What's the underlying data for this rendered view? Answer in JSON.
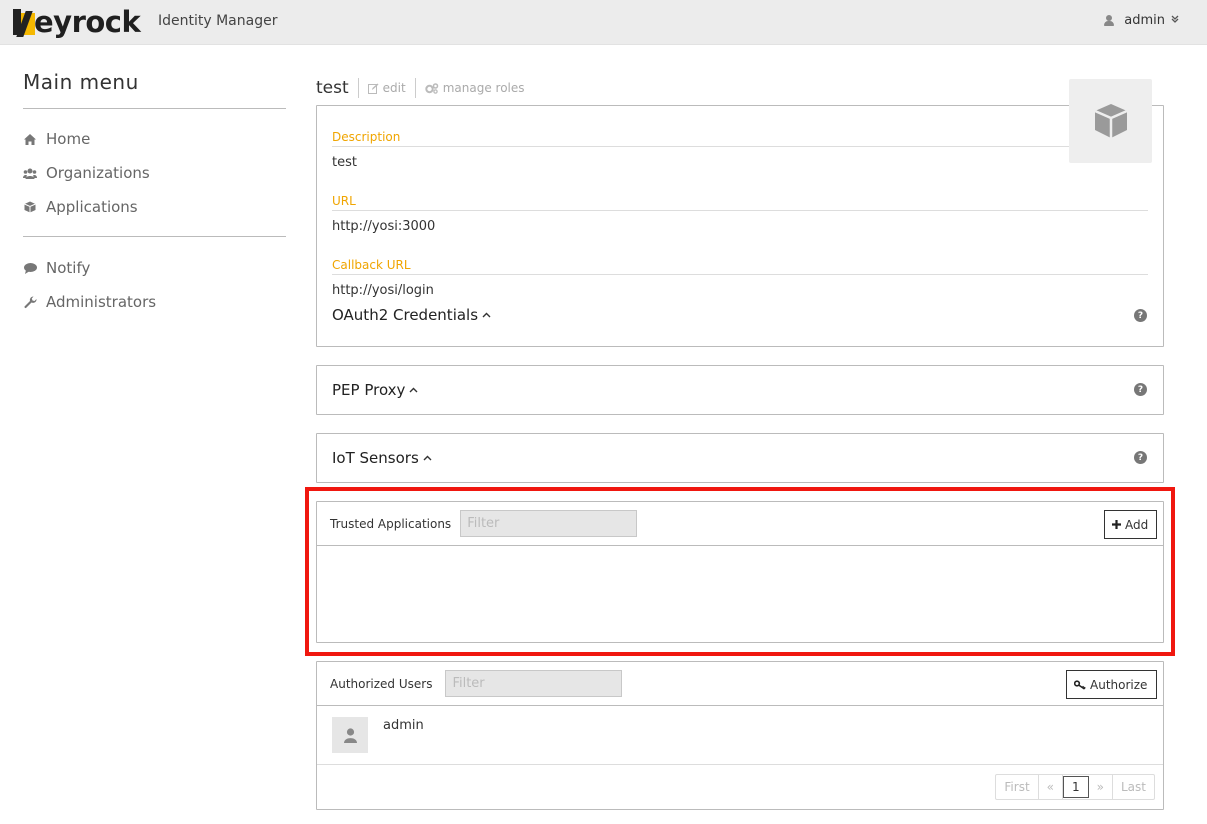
{
  "header": {
    "logo_text": "eyrock",
    "app_title": "Identity Manager",
    "user": "admin",
    "user_icon": "user-icon",
    "user_menu_icon": "chevron-down-icon"
  },
  "sidebar": {
    "title": "Main menu",
    "groups": [
      [
        {
          "label": "Home",
          "icon": "home-icon"
        },
        {
          "label": "Organizations",
          "icon": "users-icon"
        },
        {
          "label": "Applications",
          "icon": "cube-icon"
        }
      ],
      [
        {
          "label": "Notify",
          "icon": "comment-icon"
        },
        {
          "label": "Administrators",
          "icon": "wrench-icon"
        }
      ]
    ]
  },
  "app": {
    "name": "test",
    "edit_label": "edit",
    "manage_roles_label": "manage roles",
    "icon": "cube-icon"
  },
  "details": {
    "description_label": "Description",
    "description_value": "test",
    "url_label": "URL",
    "url_value": "http://yosi:3000",
    "callback_label": "Callback URL",
    "callback_value": "http://yosi/login",
    "oauth_label": "OAuth2 Credentials"
  },
  "sections": {
    "pep_proxy": "PEP Proxy",
    "iot_sensors": "IoT Sensors"
  },
  "trusted": {
    "label": "Trusted Applications",
    "filter_placeholder": "Filter",
    "add_label": "Add"
  },
  "authorized": {
    "label": "Authorized Users",
    "filter_placeholder": "Filter",
    "authorize_label": "Authorize",
    "users": [
      {
        "name": "admin"
      }
    ],
    "pagination": {
      "first": "First",
      "prev": "«",
      "current": "1",
      "next": "»",
      "last": "Last"
    }
  },
  "colors": {
    "accent": "#f0a500",
    "highlight": "#f0170f",
    "logo_yellow": "#f5b800"
  }
}
